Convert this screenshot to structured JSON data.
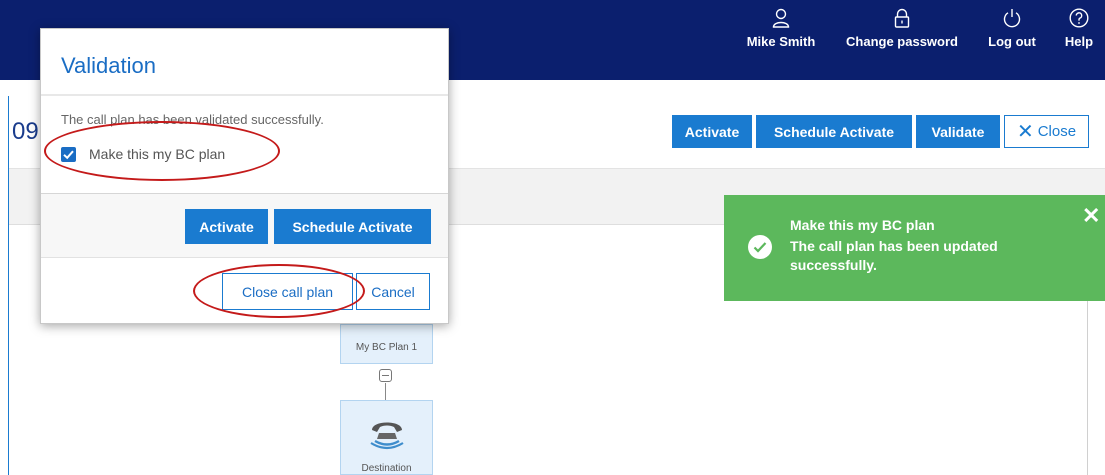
{
  "colors": {
    "nav_bg": "#0b1f6e",
    "primary": "#1a7bd0",
    "title_blue": "#1a6dc4",
    "success": "#5cb85c",
    "annotation_red": "#c41a1a"
  },
  "nav": {
    "user": {
      "icon": "user-icon",
      "label": "Mike Smith"
    },
    "change_password": {
      "icon": "lock-icon",
      "label": "Change password"
    },
    "logout": {
      "icon": "power-icon",
      "label": "Log out"
    },
    "help": {
      "icon": "help-icon",
      "label": "Help"
    }
  },
  "page": {
    "title_fragment": "09",
    "actions": {
      "activate": "Activate",
      "schedule_activate": "Schedule Activate",
      "validate": "Validate",
      "close": "Close"
    }
  },
  "flow": {
    "plan_node": "My BC Plan 1",
    "destination_node": "Destination",
    "destination_icon": "phone-icon"
  },
  "dialog": {
    "title": "Validation",
    "message": "The call plan has been validated successfully.",
    "bc_checkbox": {
      "label": "Make this my BC plan",
      "checked": true
    },
    "buttons": {
      "activate": "Activate",
      "schedule_activate": "Schedule Activate",
      "close_call_plan": "Close call plan",
      "cancel": "Cancel"
    }
  },
  "toast": {
    "title": "Make this my BC plan",
    "message": "The call plan has been updated successfully.",
    "icon": "check-circle-icon",
    "close": "✕"
  }
}
